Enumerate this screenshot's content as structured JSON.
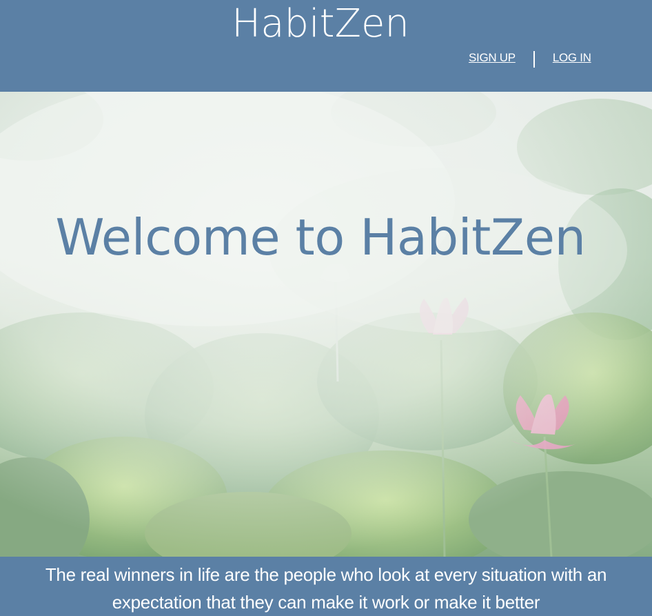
{
  "header": {
    "logo_text": "HabitZen",
    "signup_label": "SIGN UP",
    "login_label": "LOG IN"
  },
  "hero": {
    "title": "Welcome to HabitZen"
  },
  "quote": {
    "text": "The real winners in life are the people who look at every situation with an expectation that they can make it work or make it better"
  },
  "colors": {
    "brand": "#5b80a5",
    "text_on_brand": "#ffffff"
  }
}
